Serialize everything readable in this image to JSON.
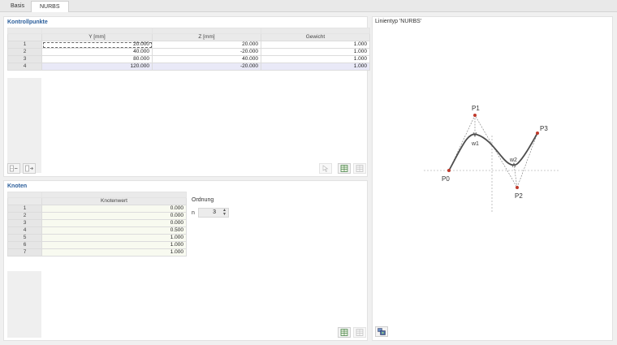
{
  "tabs": [
    {
      "label": "Basis",
      "active": false
    },
    {
      "label": "NURBS",
      "active": true
    }
  ],
  "control_points": {
    "title": "Kontrollpunkte",
    "columns": [
      "Y [mm]",
      "Z [mm]",
      "Gewicht"
    ],
    "rows": [
      {
        "no": "1",
        "y": "20.000",
        "z": "20.000",
        "w": "1.000"
      },
      {
        "no": "2",
        "y": "40.000",
        "z": "-20.000",
        "w": "1.000"
      },
      {
        "no": "3",
        "y": "80.000",
        "z": "40.000",
        "w": "1.000"
      },
      {
        "no": "4",
        "y": "120.000",
        "z": "-20.000",
        "w": "1.000"
      }
    ]
  },
  "knots": {
    "title": "Knoten",
    "column": "Knotenwert",
    "rows": [
      {
        "no": "1",
        "value": "0.000"
      },
      {
        "no": "2",
        "value": "0.000"
      },
      {
        "no": "3",
        "value": "0.000"
      },
      {
        "no": "4",
        "value": "0.500"
      },
      {
        "no": "5",
        "value": "1.000"
      },
      {
        "no": "6",
        "value": "1.000"
      },
      {
        "no": "7",
        "value": "1.000"
      }
    ],
    "order_label": "Ordnung",
    "n_label": "n",
    "n_value": "3"
  },
  "diagram": {
    "title": "Linientyp 'NURBS'",
    "labels": {
      "p0": "P0",
      "p1": "P1",
      "p2": "P2",
      "p3": "P3",
      "w1": "w1",
      "w2": "w2"
    },
    "colors": {
      "curve": "#4d4d4d",
      "point": "#c0392b",
      "dashed": "#777777",
      "axis": "#999999"
    }
  },
  "icons": {
    "insert_row": "insert-row-icon",
    "delete_row": "delete-row-icon",
    "pick": "pick-cursor-icon",
    "import_table": "import-table-icon",
    "export_table": "export-table-icon",
    "view_options": "view-options-icon"
  }
}
